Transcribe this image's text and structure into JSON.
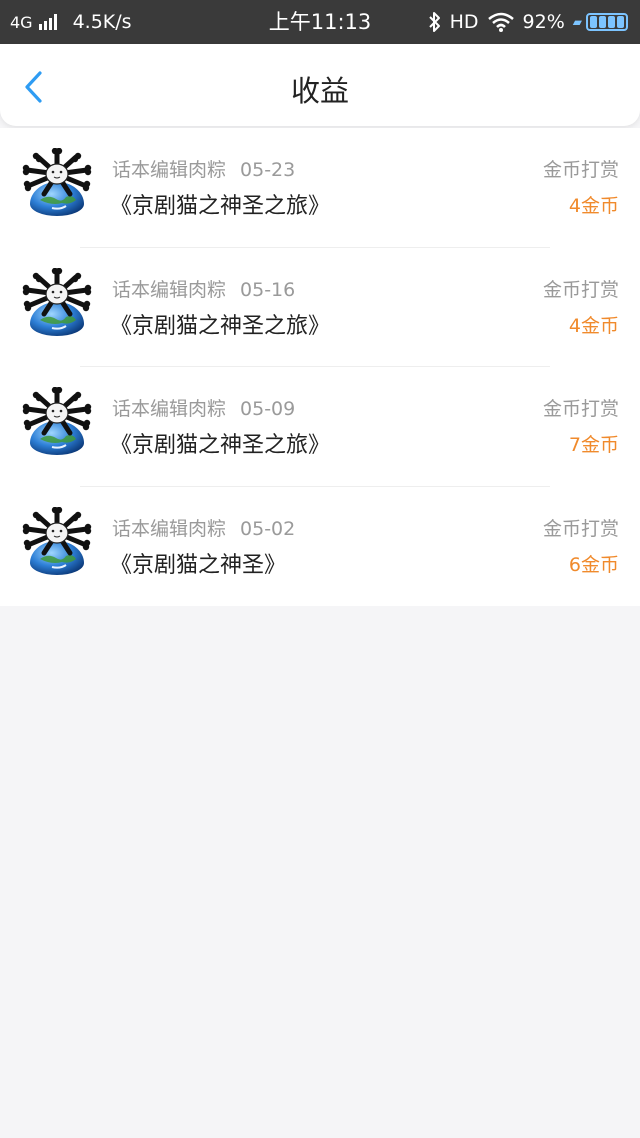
{
  "status_bar": {
    "network": "4G",
    "speed": "4.5K/s",
    "time": "上午11:13",
    "hd": "HD",
    "battery": "92%"
  },
  "nav": {
    "title": "收益"
  },
  "items": [
    {
      "author": "话本编辑肉粽",
      "date": "05-23",
      "title": "《京剧猫之神圣之旅》",
      "type": "金币打赏",
      "amount": "4金币"
    },
    {
      "author": "话本编辑肉粽",
      "date": "05-16",
      "title": "《京剧猫之神圣之旅》",
      "type": "金币打赏",
      "amount": "4金币"
    },
    {
      "author": "话本编辑肉粽",
      "date": "05-09",
      "title": "《京剧猫之神圣之旅》",
      "type": "金币打赏",
      "amount": "7金币"
    },
    {
      "author": "话本编辑肉粽",
      "date": "05-02",
      "title": "《京剧猫之神圣》",
      "type": "金币打赏",
      "amount": "6金币"
    }
  ],
  "colors": {
    "accent": "#2e9cf3",
    "amount": "#f08a2c"
  }
}
